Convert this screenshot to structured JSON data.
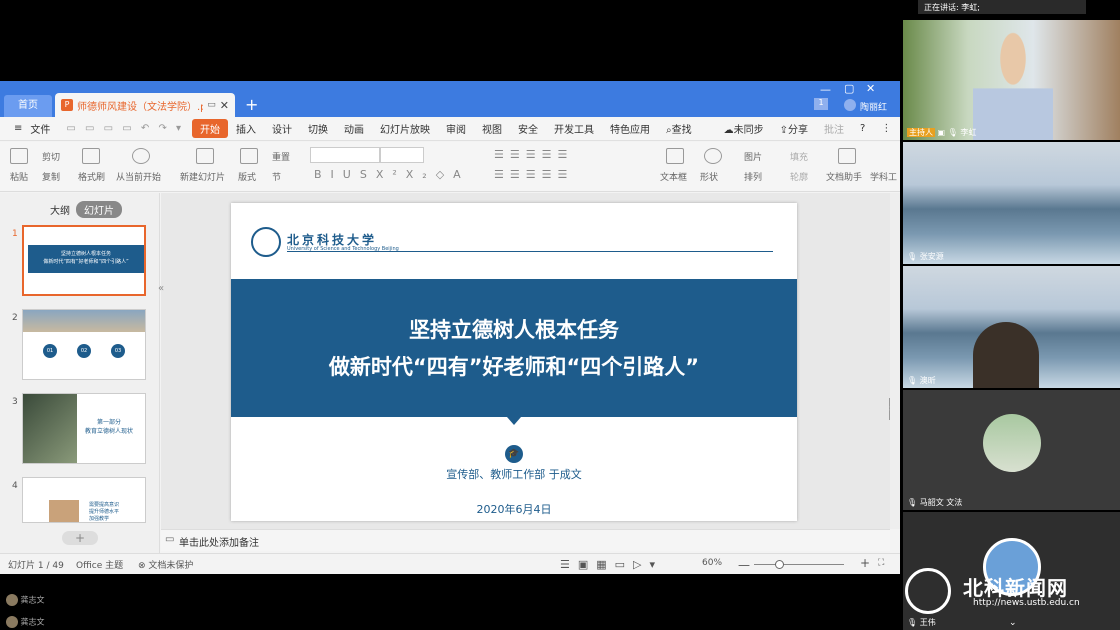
{
  "top_status": {
    "speaking": "正在讲话: 李虹;"
  },
  "wps": {
    "tabs": {
      "home": "首页",
      "doc": "师德师风建设（文法学院）.pptx"
    },
    "window": {
      "user": "陶丽红"
    },
    "menu": {
      "file": "文件",
      "items": [
        "开始",
        "插入",
        "设计",
        "切换",
        "动画",
        "幻灯片放映",
        "审阅",
        "视图",
        "安全",
        "开发工具",
        "特色应用"
      ],
      "search": "查找",
      "sync": "未同步",
      "share": "分享",
      "comment": "批注"
    },
    "ribbon": {
      "paste": "粘贴",
      "cut": "剪切",
      "copy": "复制",
      "format_painter": "格式刷",
      "from_current": "从当前开始",
      "new_slide": "新建幻灯片",
      "layout": "版式",
      "reset": "重置",
      "section": "节",
      "textbox": "文本框",
      "shape": "形状",
      "picture": "图片",
      "arrange": "排列",
      "fill": "填充",
      "outline": "轮廓",
      "doc_assistant": "文档助手",
      "subject": "学科工"
    },
    "left_panel": {
      "outline_tab": "大纲",
      "slides_tab": "幻灯片"
    },
    "thumbnails": [
      {
        "num": "1",
        "line1": "坚持立德树人根本任务",
        "line2": "做新时代“四有”好老师和“四个引路人”"
      },
      {
        "num": "2",
        "items": [
          "01",
          "02",
          "03"
        ]
      },
      {
        "num": "3",
        "line1": "第一部分",
        "line2": "教育立德树人现状"
      },
      {
        "num": "4",
        "lines": [
          "需要提高意识",
          "提升师德水平",
          "加强教学",
          "要求"
        ]
      }
    ],
    "slide": {
      "university_name": "北京科技大学",
      "university_en": "University of Science and Technology Beijing",
      "title_line1": "坚持立德树人根本任务",
      "title_line2": "做新时代“四有”好老师和“四个引路人”",
      "presenter": "宣传部、教师工作部  于成文",
      "date": "2020年6月4日"
    },
    "notes_placeholder": "单击此处添加备注",
    "status": {
      "slide_count": "幻灯片 1 / 49",
      "theme": "Office 主题",
      "protection": "文档未保护",
      "zoom": "60%"
    }
  },
  "participants": [
    {
      "name": "李虹",
      "role": "主持人"
    },
    {
      "name": "张安源"
    },
    {
      "name": "澳昕"
    },
    {
      "name": "马韶文 文法"
    },
    {
      "name": "王伟"
    }
  ],
  "chat_list": [
    {
      "name": "龚志文"
    },
    {
      "name": "龚志文"
    }
  ],
  "watermark": {
    "site_name": "北科新闻网",
    "url": "http://news.ustb.edu.cn"
  },
  "colors": {
    "accent": "#e8662c",
    "tabbar": "#3d7be0",
    "slide_banner": "#1e5c8c"
  }
}
